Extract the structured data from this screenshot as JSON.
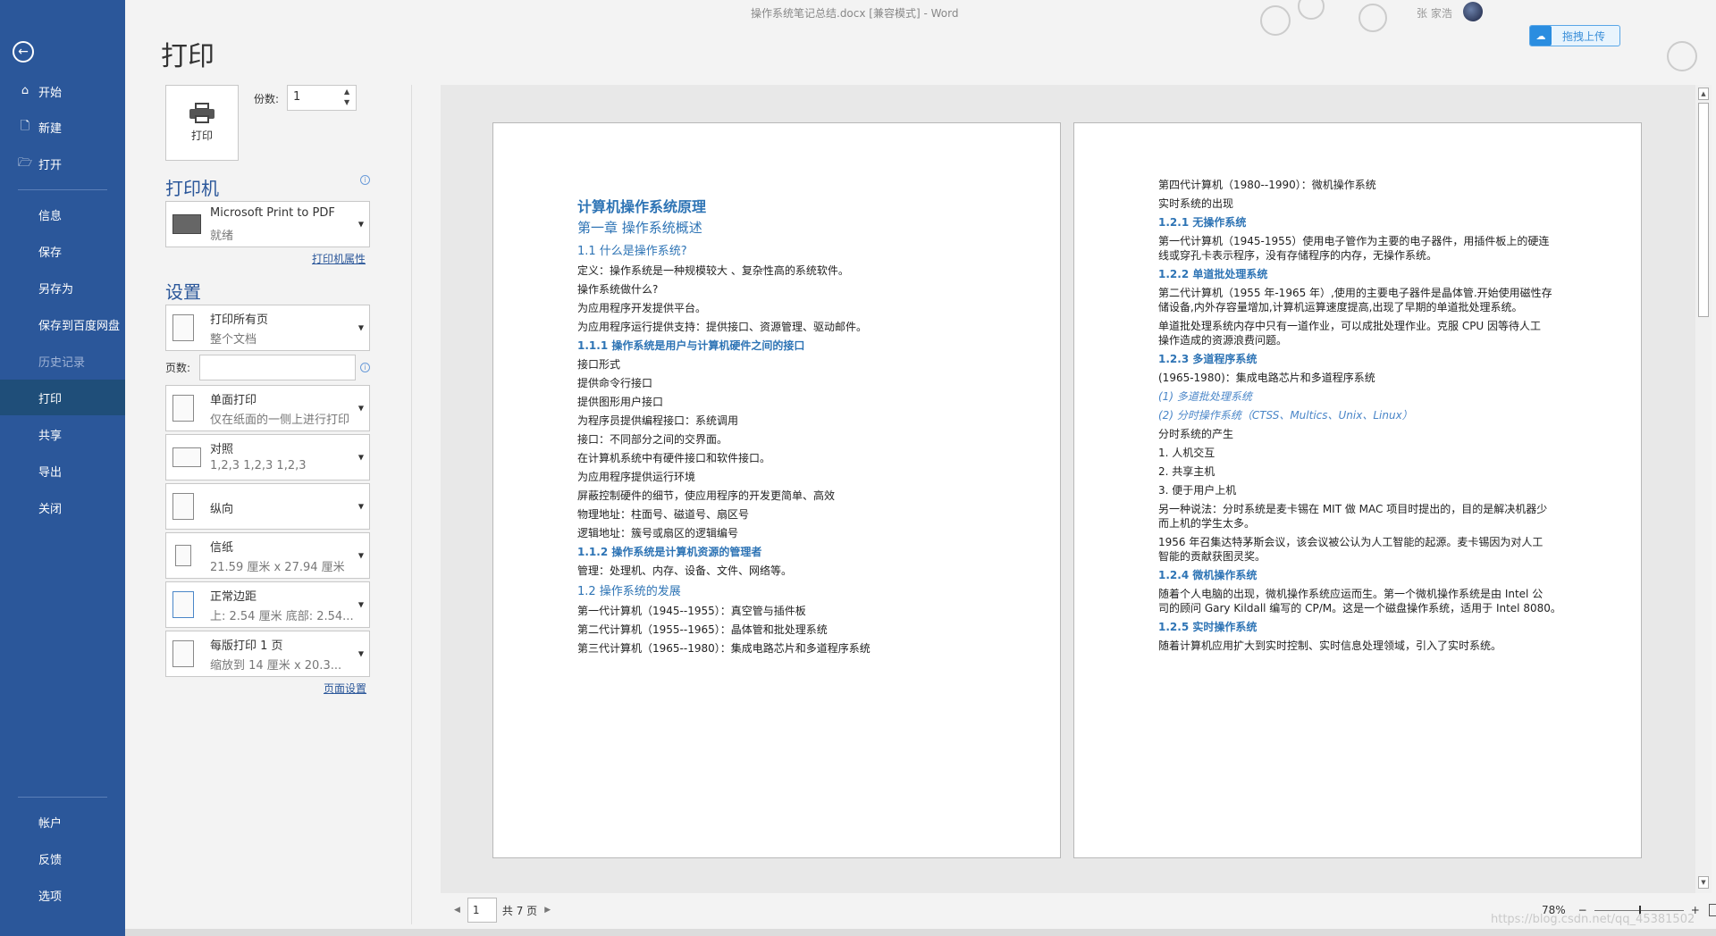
{
  "window": {
    "title": "操作系统笔记总结.docx [兼容模式] - Word",
    "user_name": "张 家浩",
    "baidu_upload": "拖拽上传"
  },
  "nav": {
    "back_icon": "back-arrow-icon",
    "items": [
      {
        "label": "开始",
        "icon": "home-icon"
      },
      {
        "label": "新建",
        "icon": "new-doc-icon"
      },
      {
        "label": "打开",
        "icon": "open-folder-icon"
      },
      {
        "label": "信息"
      },
      {
        "label": "保存"
      },
      {
        "label": "另存为"
      },
      {
        "label": "保存到百度网盘"
      },
      {
        "label": "历史记录"
      },
      {
        "label": "打印"
      },
      {
        "label": "共享"
      },
      {
        "label": "导出"
      },
      {
        "label": "关闭"
      },
      {
        "label": "帐户"
      },
      {
        "label": "反馈"
      },
      {
        "label": "选项"
      }
    ],
    "active": "打印",
    "colors": {
      "nav_bg": "#2b579a",
      "active_bg": "#1f4e79"
    }
  },
  "print": {
    "page_title": "打印",
    "print_button": "打印",
    "copies_label": "份数:",
    "copies_value": "1",
    "printer_heading": "打印机",
    "printer": {
      "name": "Microsoft Print to PDF",
      "status": "就绪"
    },
    "printer_props_link": "打印机属性",
    "settings_heading": "设置",
    "range": {
      "main": "打印所有页",
      "sub": "整个文档"
    },
    "pages_label": "页数:",
    "pages_value": "",
    "sides": {
      "main": "单面打印",
      "sub": "仅在纸面的一侧上进行打印"
    },
    "collate": {
      "main": "对照",
      "sub": "1,2,3    1,2,3    1,2,3"
    },
    "orientation": {
      "main": "纵向"
    },
    "paper": {
      "main": "信纸",
      "sub": "21.59 厘米 x 27.94 厘米"
    },
    "margins": {
      "main": "正常边距",
      "sub": "上: 2.54 厘米 底部: 2.54..."
    },
    "per_sheet": {
      "main": "每版打印 1 页",
      "sub": "缩放到 14 厘米 x 20.3..."
    },
    "page_setup_link": "页面设置"
  },
  "preview": {
    "page_left": [
      {
        "t": "计算机操作系统原理",
        "c": "h1"
      },
      {
        "t": "第一章 操作系统概述",
        "c": "h2"
      },
      {
        "t": "1.1 什么是操作系统?",
        "c": "h3"
      },
      {
        "t": "定义：操作系统是一种规模较大 、复杂性高的系统软件。",
        "c": ""
      },
      {
        "t": "操作系统做什么?",
        "c": ""
      },
      {
        "t": "为应用程序开发提供平台。",
        "c": ""
      },
      {
        "t": "为应用程序运行提供支持：提供接口、资源管理、驱动邮件。",
        "c": ""
      },
      {
        "t": "1.1.1 操作系统是用户与计算机硬件之间的接口",
        "c": "h4"
      },
      {
        "t": "接口形式",
        "c": ""
      },
      {
        "t": "提供命令行接口",
        "c": ""
      },
      {
        "t": "提供图形用户接口",
        "c": ""
      },
      {
        "t": "为程序员提供编程接口：系统调用",
        "c": ""
      },
      {
        "t": "接口：不同部分之间的交界面。",
        "c": ""
      },
      {
        "t": "在计算机系统中有硬件接口和软件接口。",
        "c": ""
      },
      {
        "t": "为应用程序提供运行环境",
        "c": ""
      },
      {
        "t": "屏蔽控制硬件的细节，使应用程序的开发更简单、高效",
        "c": ""
      },
      {
        "t": "物理地址：柱面号、磁道号、扇区号",
        "c": ""
      },
      {
        "t": "逻辑地址：簇号或扇区的逻辑编号",
        "c": ""
      },
      {
        "t": "1.1.2 操作系统是计算机资源的管理者",
        "c": "h4"
      },
      {
        "t": "管理：处理机、内存、设备、文件、网络等。",
        "c": ""
      },
      {
        "t": "1.2 操作系统的发展",
        "c": "h3"
      },
      {
        "t": "第一代计算机（1945--1955）：真空管与插件板",
        "c": ""
      },
      {
        "t": "第二代计算机（1955--1965）：晶体管和批处理系统",
        "c": ""
      },
      {
        "t": "第三代计算机（1965--1980）：集成电路芯片和多道程序系统",
        "c": ""
      }
    ],
    "page_right": [
      {
        "t": "第四代计算机（1980--1990）：微机操作系统",
        "c": ""
      },
      {
        "t": "实时系统的出现",
        "c": ""
      },
      {
        "t": "1.2.1 无操作系统",
        "c": "h4"
      },
      {
        "t": "第一代计算机（1945-1955）使用电子管作为主要的电子器件，用插件板上的硬连",
        "c": ""
      },
      {
        "t": "线或穿孔卡表示程序，没有存储程序的内存，无操作系统。",
        "c": ""
      },
      {
        "t": "1.2.2 单道批处理系统",
        "c": "h4"
      },
      {
        "t": "第二代计算机（1955 年-1965 年）,使用的主要电子器件是晶体管.开始使用磁性存",
        "c": ""
      },
      {
        "t": "储设备,内外存容量增加,计算机运算速度提高,出现了早期的单道批处理系统。",
        "c": ""
      },
      {
        "t": "单道批处理系统内存中只有一道作业，可以成批处理作业。克服 CPU 因等待人工",
        "c": ""
      },
      {
        "t": "操作造成的资源浪费问题。",
        "c": ""
      },
      {
        "t": "1.2.3 多道程序系统",
        "c": "h4"
      },
      {
        "t": "(1965-1980)：集成电路芯片和多道程序系统",
        "c": ""
      },
      {
        "t": "(1) 多道批处理系统",
        "c": "it"
      },
      {
        "t": "(2) 分时操作系统（CTSS、Multics、Unix、Linux）",
        "c": "it"
      },
      {
        "t": "分时系统的产生",
        "c": ""
      },
      {
        "t": "1.    人机交互",
        "c": ""
      },
      {
        "t": "2.    共享主机",
        "c": ""
      },
      {
        "t": "3.    便于用户上机",
        "c": ""
      },
      {
        "t": "另一种说法：分时系统是麦卡锡在 MIT 做 MAC 项目时提出的，目的是解决机器少",
        "c": ""
      },
      {
        "t": "而上机的学生太多。",
        "c": ""
      },
      {
        "t": "1956 年召集达特茅斯会议，该会议被公认为人工智能的起源。麦卡锡因为对人工",
        "c": ""
      },
      {
        "t": "智能的贡献获图灵奖。",
        "c": ""
      },
      {
        "t": "1.2.4 微机操作系统",
        "c": "h4"
      },
      {
        "t": "随着个人电脑的出现，微机操作系统应运而生。第一个微机操作系统是由 Intel 公",
        "c": ""
      },
      {
        "t": "司的顾问 Gary Kildall 编写的 CP/M。这是一个磁盘操作系统，适用于 Intel 8080。",
        "c": ""
      },
      {
        "t": "1.2.5 实时操作系统",
        "c": "h4"
      },
      {
        "t": "随着计算机应用扩大到实时控制、实时信息处理领域，引入了实时系统。",
        "c": ""
      }
    ]
  },
  "footer": {
    "current_page": "1",
    "total_pages": "共 7 页",
    "zoom": "78%",
    "zoom_minus": "−",
    "zoom_plus": "+",
    "watermark": "https://blog.csdn.net/qq_45381502"
  }
}
